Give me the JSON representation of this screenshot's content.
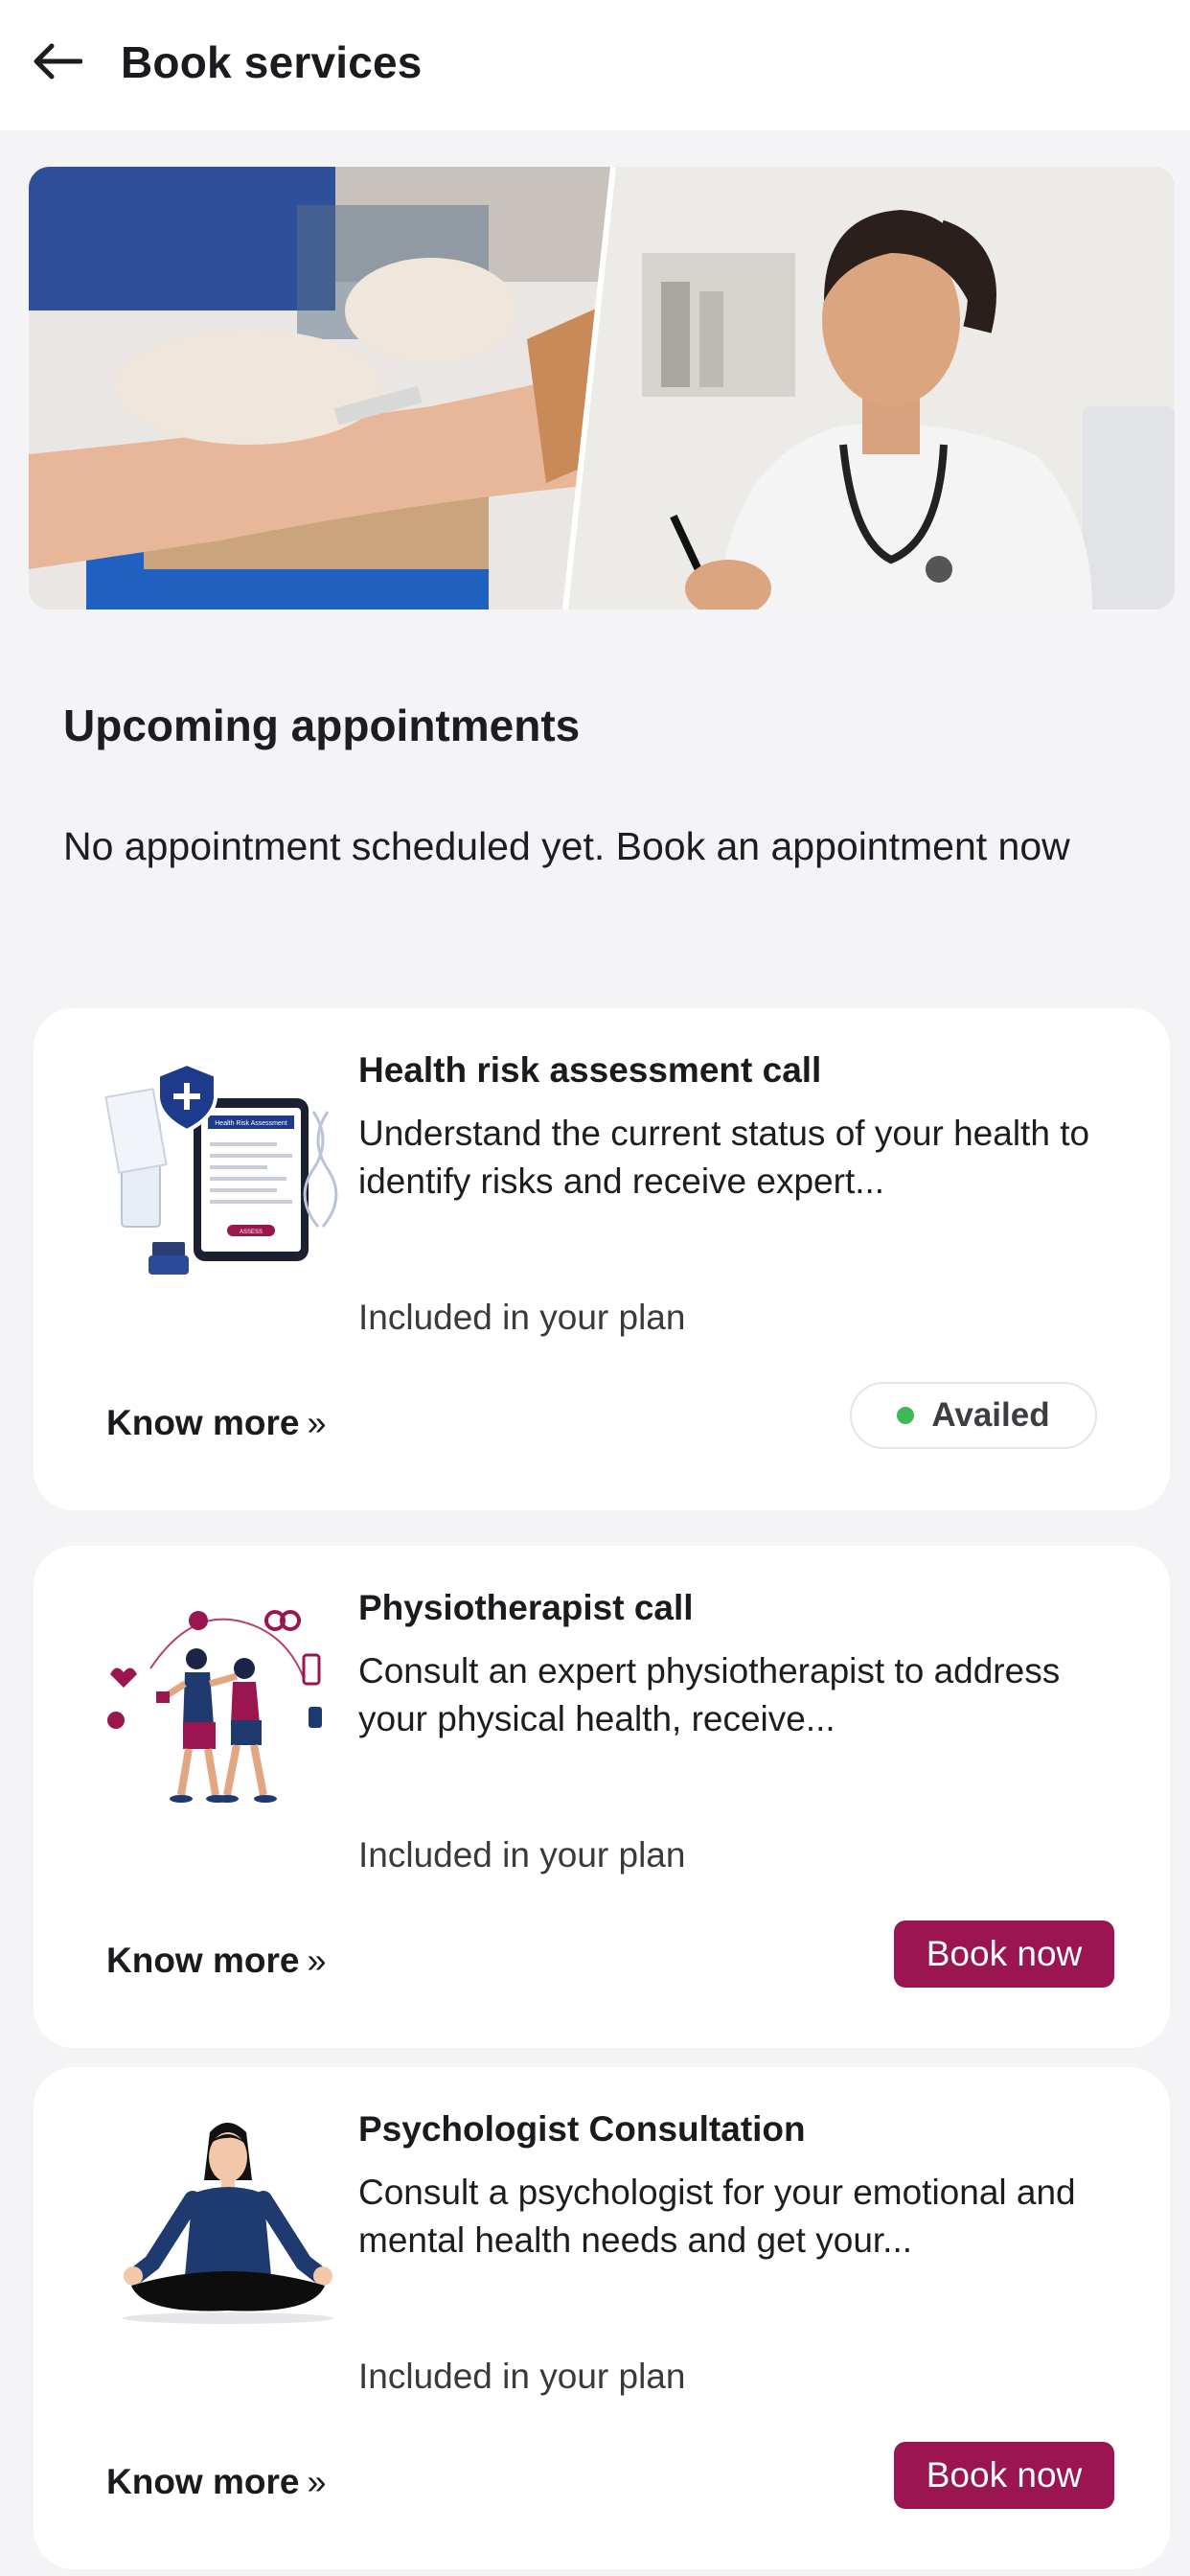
{
  "header": {
    "title": "Book services"
  },
  "appointments": {
    "section_title": "Upcoming appointments",
    "empty_message": "No appointment scheduled yet. Book an appointment now"
  },
  "services": [
    {
      "title": "Health risk assessment call",
      "description": "Understand the current status of your health to identify risks and receive expert...",
      "plan_text": "Included in your plan",
      "know_more": "Know more",
      "status": "Availed",
      "illustration": "health-risk-assessment-tablet-illustration",
      "illustration_text": "Health Risk Assessment",
      "illustration_button": "ASSESS"
    },
    {
      "title": "Physiotherapist call",
      "description": "Consult an expert physiotherapist to address your physical health, receive...",
      "plan_text": "Included in your plan",
      "know_more": "Know more",
      "action": "Book now",
      "illustration": "fitness-couple-illustration"
    },
    {
      "title": "Psychologist Consultation",
      "description": "Consult a psychologist for your emotional and mental health needs and get your...",
      "plan_text": "Included in your plan",
      "know_more": "Know more",
      "action": "Book now",
      "illustration": "meditation-woman-illustration"
    }
  ],
  "colors": {
    "accent": "#9b1551",
    "availed_dot": "#3dba55",
    "navy": "#1e3a6e",
    "background": "#f4f4f6"
  }
}
